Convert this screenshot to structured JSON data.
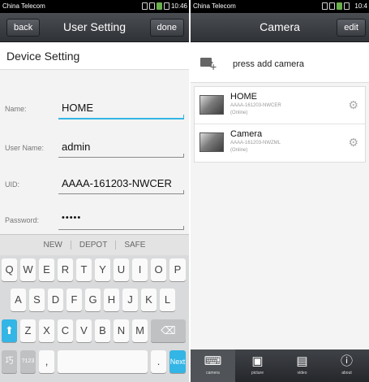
{
  "left": {
    "status": {
      "carrier": "China Telecom",
      "time": "10:46"
    },
    "title": "User Setting",
    "back_label": "back",
    "done_label": "done",
    "section_title": "Device Setting",
    "fields": [
      {
        "label": "Name:",
        "value": "HOME"
      },
      {
        "label": "User Name:",
        "value": "admin"
      },
      {
        "label": "UID:",
        "value": "AAAA-161203-NWCER"
      },
      {
        "label": "Password:",
        "value": "•••••"
      }
    ],
    "suggestions": [
      "NEW",
      "DEPOT",
      "SAFE"
    ],
    "keyboard": {
      "row1": [
        "Q",
        "W",
        "E",
        "R",
        "T",
        "Y",
        "U",
        "I",
        "O",
        "P"
      ],
      "row2": [
        "A",
        "S",
        "D",
        "F",
        "G",
        "H",
        "J",
        "K",
        "L"
      ],
      "row3": [
        "Z",
        "X",
        "C",
        "V",
        "B",
        "N",
        "M"
      ],
      "shift": "⬆",
      "delete": "⌫",
      "lang": "巧",
      "sym": "?123",
      "comma": ",",
      "period": ".",
      "next": "Next"
    }
  },
  "right": {
    "status": {
      "carrier": "China Telecom",
      "time": "10:4"
    },
    "title": "Camera",
    "edit_label": "edit",
    "add_label": "press add camera",
    "cameras": [
      {
        "name": "HOME",
        "uid": "AAAA-161203-NWCER",
        "status": "(Online)"
      },
      {
        "name": "Camera",
        "uid": "AAAA-161203-NWZML",
        "status": "(Online)"
      }
    ],
    "tabs": [
      {
        "icon": "camera-icon",
        "glyph": "⌨",
        "label": "camera"
      },
      {
        "icon": "picture-icon",
        "glyph": "▣",
        "label": "picture"
      },
      {
        "icon": "video-icon",
        "glyph": "▤",
        "label": "video"
      },
      {
        "icon": "info-icon",
        "glyph": "ⓘ",
        "label": "about"
      }
    ]
  }
}
